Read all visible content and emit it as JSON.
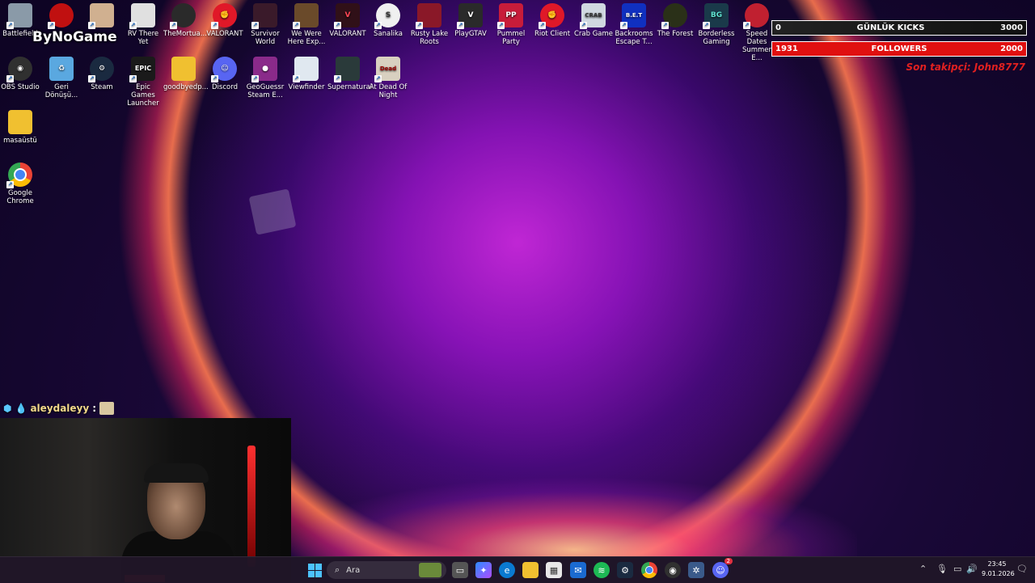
{
  "overlay": {
    "brand": "ByNoGame",
    "kicks": {
      "current": "0",
      "label": "GÜNLÜK KICKS",
      "goal": "3000"
    },
    "followers": {
      "current": "1931",
      "label": "FOLLOWERS",
      "goal": "2000"
    },
    "last_follower": "Son takipçi: John8777"
  },
  "chat": {
    "username": "aleydaleyy",
    "separator": ":"
  },
  "desktop_icons": [
    {
      "label": "Battlefield",
      "color": "#8a9aa8"
    },
    {
      "label": "",
      "color": "#c01010"
    },
    {
      "label": "",
      "color": "#d0b090"
    },
    {
      "label": "RV There Yet",
      "color": "#e0e0e0"
    },
    {
      "label": "TheMortua...",
      "color": "#2a2a2a"
    },
    {
      "label": "VALORANT",
      "color": "#e01828"
    },
    {
      "label": "Survivor World",
      "color": "#3a1a2a"
    },
    {
      "label": "We Were Here Exp...",
      "color": "#6a4a2a"
    },
    {
      "label": "VALORANT",
      "color": "#301018"
    },
    {
      "label": "Sanalika",
      "color": "#f0f0f0"
    },
    {
      "label": "Rusty Lake Roots",
      "color": "#8a1828"
    },
    {
      "label": "PlayGTAV",
      "color": "#2a2a2a"
    },
    {
      "label": "Pummel Party",
      "color": "#c81c3a"
    },
    {
      "label": "Riot Client",
      "color": "#e01828"
    },
    {
      "label": "Crab Game",
      "color": "#d0d8e0"
    },
    {
      "label": "Backrooms Escape T...",
      "color": "#1030c0"
    },
    {
      "label": "The Forest",
      "color": "#2a3018"
    },
    {
      "label": "Borderless Gaming",
      "color": "#1a3a4a"
    },
    {
      "label": "Speed Dates Summer E...",
      "color": "#c02030"
    },
    {
      "label": "OBS Studio",
      "color": "#303030"
    },
    {
      "label": "Geri Dönüşü...",
      "color": "#5aa8e0"
    },
    {
      "label": "Steam",
      "color": "#1a2a40"
    },
    {
      "label": "Epic Games Launcher",
      "color": "#1a1a1a"
    },
    {
      "label": "goodbyedp...",
      "color": "#f0c030"
    },
    {
      "label": "Discord",
      "color": "#5865f2"
    },
    {
      "label": "GeoGuessr Steam E...",
      "color": "#8a2a8a"
    },
    {
      "label": "Viewfinder",
      "color": "#e0e8f0"
    },
    {
      "label": "Supernatural",
      "color": "#2a3a3a"
    },
    {
      "label": "At Dead Of Night",
      "color": "#d8d0c0"
    },
    {
      "label": "masaüstü",
      "color": "#f0c030"
    },
    {
      "label": "Google Chrome",
      "color": "#e0e0e0"
    }
  ],
  "taskbar": {
    "search_placeholder": "Ara",
    "discord_badge": "2",
    "time": "23:45",
    "date": "9.01.2026"
  }
}
